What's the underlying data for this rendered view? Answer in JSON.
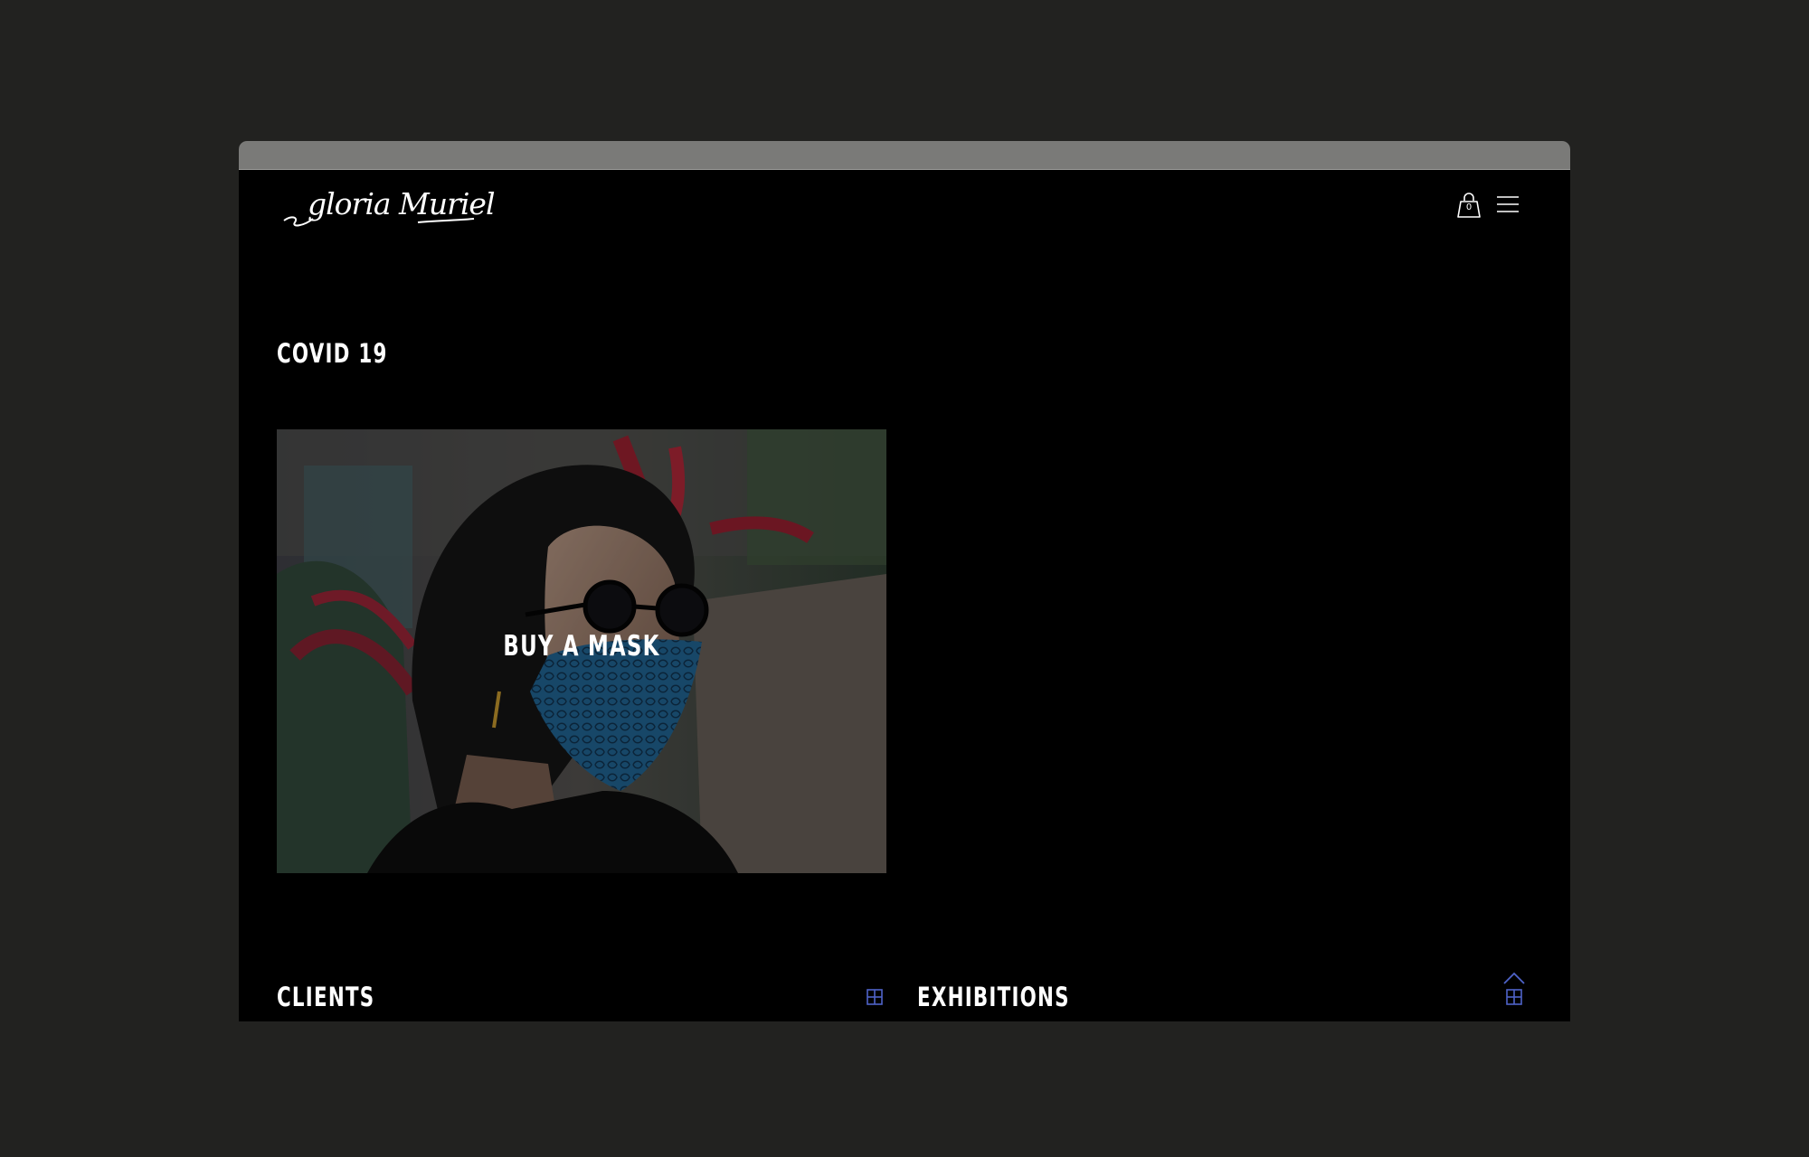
{
  "brand": {
    "logo_text": "gloria Muriel"
  },
  "header": {
    "cart_count": "0"
  },
  "sections": {
    "covid": {
      "title": "COVID 19",
      "card_label": "BUY A MASK"
    },
    "clients": {
      "title": "CLIENTS"
    },
    "exhibitions": {
      "title": "EXHIBITIONS"
    }
  },
  "colors": {
    "accent": "#4f63c9",
    "background": "#000000",
    "frame": "#222220"
  }
}
